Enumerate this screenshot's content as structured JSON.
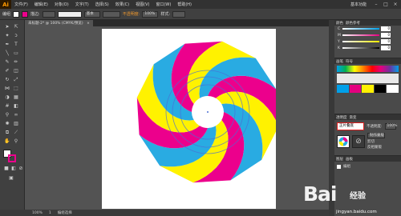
{
  "menubar": {
    "logo": "Ai",
    "items": [
      "文件(F)",
      "编辑(E)",
      "对象(O)",
      "文字(T)",
      "选择(S)",
      "效果(C)",
      "视图(V)",
      "窗口(W)",
      "帮助(H)"
    ],
    "workspace": "基本功能",
    "window_controls": [
      "–",
      "□",
      "×"
    ]
  },
  "controlbar": {
    "selection_label": "编组",
    "stroke_label": "描边:",
    "stroke_profile": "基本",
    "opacity_label": "不透明度:",
    "opacity_value": "100%",
    "style_label": "样式:"
  },
  "document": {
    "tab_title": "未标题-2* @ 100% (CMYK/预览)",
    "tab_close": "×"
  },
  "statusbar": {
    "zoom": "100%",
    "page": "1",
    "tool": "编组选择"
  },
  "panels": {
    "color": {
      "tabs": [
        "颜色",
        "颜色参考"
      ],
      "sliders": [
        {
          "letter": "C",
          "value": "0"
        },
        {
          "letter": "M",
          "value": "0"
        },
        {
          "letter": "Y",
          "value": "0"
        },
        {
          "letter": "K",
          "value": "0"
        }
      ]
    },
    "brushes": {
      "tabs": [
        "画笔",
        "符号"
      ]
    },
    "appearance": {
      "tabs": [
        "透明度",
        "渐变"
      ],
      "blend_mode": "正片叠底",
      "opacity_label": "不透明度:",
      "opacity_value": "100%",
      "btn1": "制作蒙版",
      "check1": "剪切",
      "check2": "反相蒙版"
    },
    "layers": {
      "tabs": [
        "图层",
        "画板"
      ],
      "layer1": "编组"
    }
  },
  "watermark": {
    "logo": "Bai",
    "logo2": "经验",
    "url": "jingyan.baidu.com"
  },
  "colors": {
    "cyan": "#29abe2",
    "magenta": "#ec008c",
    "yellow": "#fff200",
    "accent": "#f29a2e"
  }
}
